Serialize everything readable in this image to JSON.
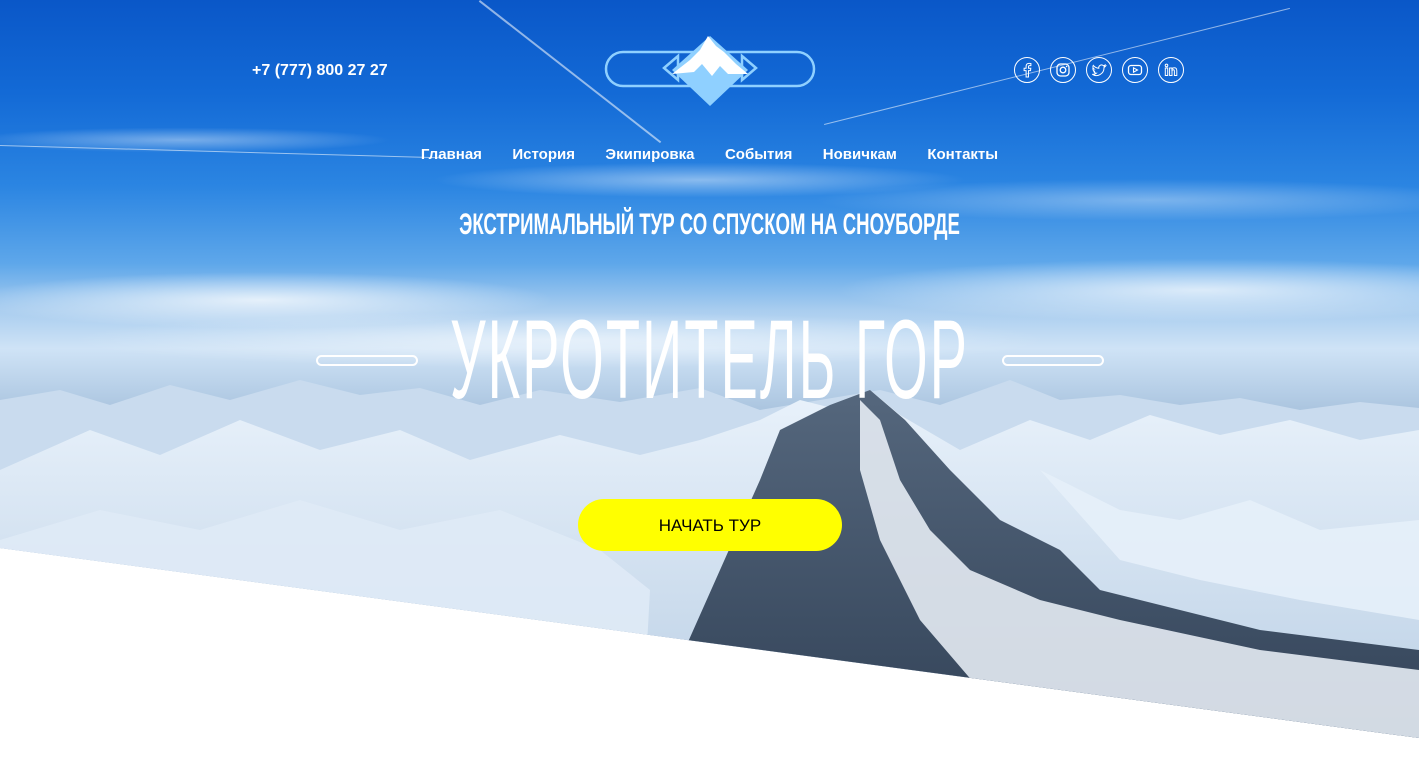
{
  "header": {
    "phone": "+7 (777) 800 27 27",
    "logo_icon": "snowboard-mountain-logo",
    "socials": [
      {
        "name": "facebook-icon"
      },
      {
        "name": "instagram-icon"
      },
      {
        "name": "twitter-icon"
      },
      {
        "name": "youtube-icon"
      },
      {
        "name": "linkedin-icon"
      }
    ]
  },
  "nav": {
    "items": [
      "Главная",
      "История",
      "Экипировка",
      "События",
      "Новичкам",
      "Контакты"
    ]
  },
  "hero": {
    "subtitle": "ЭКСТРИМАЛЬНЫЙ ТУР СО СПУСКОМ НА СНОУБОРДЕ",
    "title": "УКРОТИТЕЛЬ ГОР",
    "cta_label": "НАЧАТЬ ТУР"
  },
  "colors": {
    "sky_top": "#0a57c8",
    "accent_yellow": "#ffff00",
    "logo_blue": "#8fd0ff",
    "text_white": "#ffffff"
  }
}
